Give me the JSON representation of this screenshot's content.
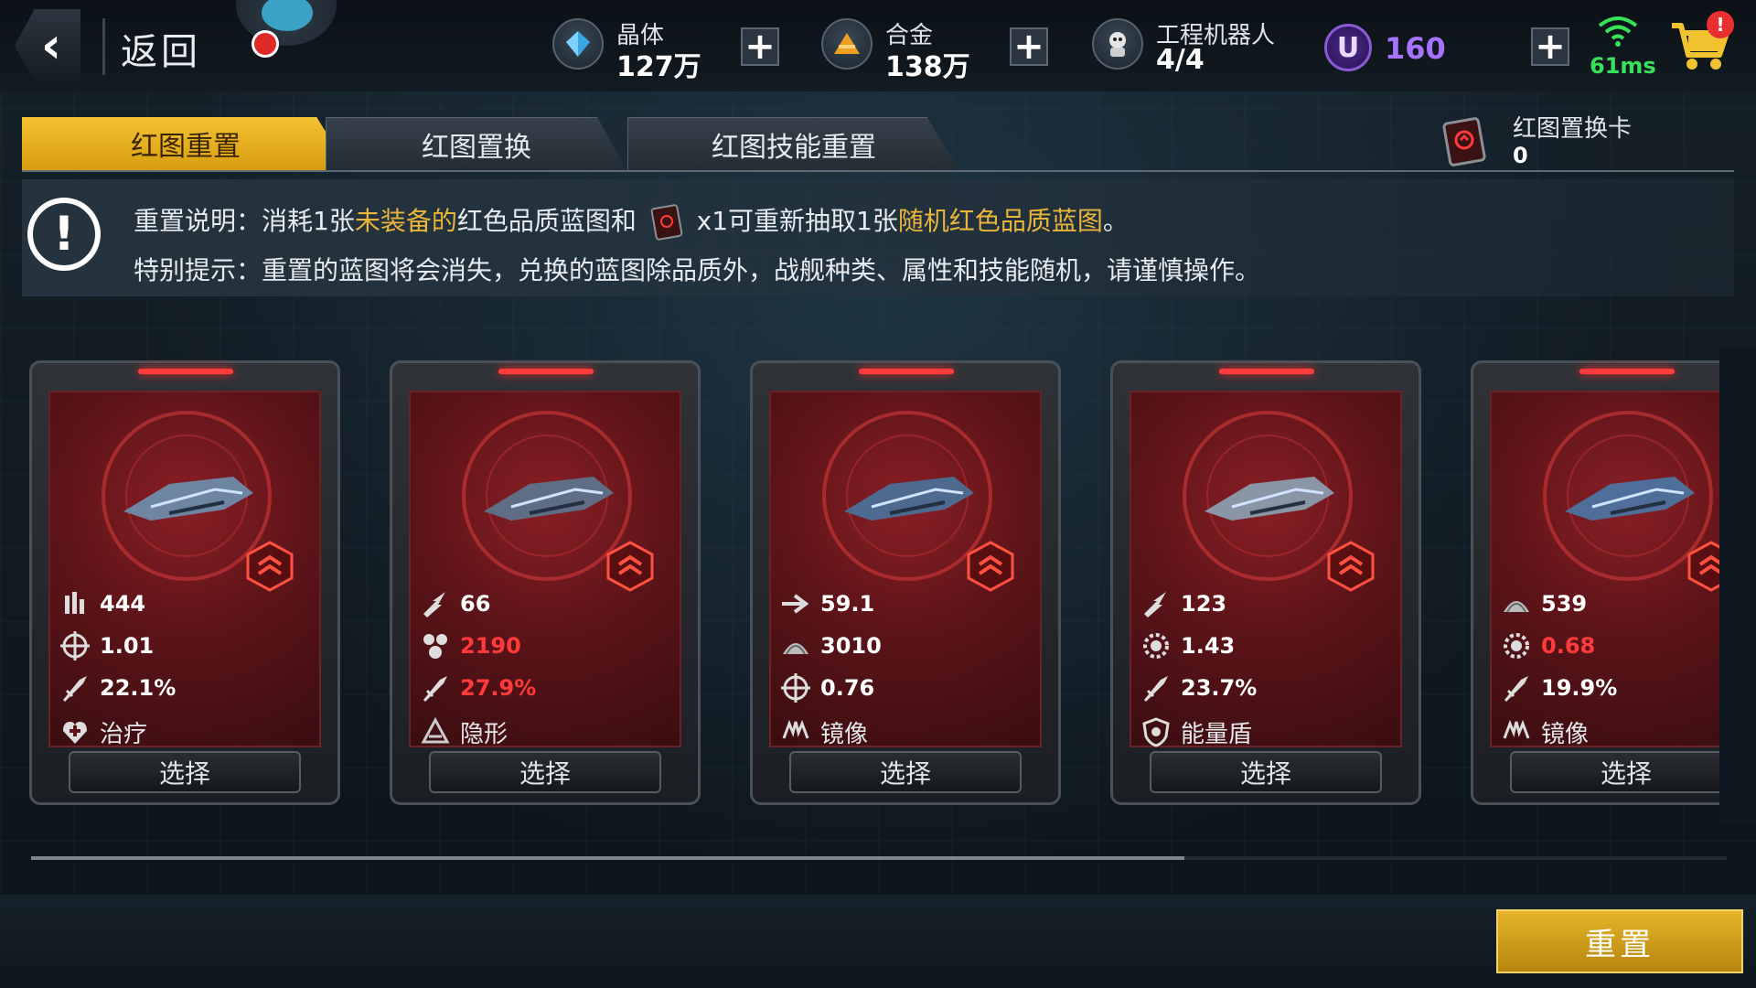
{
  "topbar": {
    "back_label": "返回",
    "resources": [
      {
        "name": "晶体",
        "value": "127万",
        "icon": "crystal-icon",
        "color": "#3aa7e6"
      },
      {
        "name": "合金",
        "value": "138万",
        "icon": "alloy-icon",
        "color": "#f0a020"
      },
      {
        "name": "工程机器人",
        "value": "4/4",
        "icon": "robot-icon",
        "color": "#e0e0e0"
      }
    ],
    "plus": "+",
    "u_label": "U",
    "u_value": "160",
    "ping": "61ms",
    "notification": "!"
  },
  "tabs": [
    {
      "label": "红图重置",
      "active": true
    },
    {
      "label": "红图置换",
      "active": false
    },
    {
      "label": "红图技能重置",
      "active": false
    }
  ],
  "swap_card": {
    "label": "红图置换卡",
    "count": "0"
  },
  "notice": {
    "line1": {
      "a": "重置说明：消耗1张",
      "b": "未装备的",
      "c": "红色品质蓝图和",
      "d": "x1可重新抽取1张",
      "e": "随机红色品质蓝图",
      "f": "。"
    },
    "line2": "特别提示：重置的蓝图将会消失，兑换的蓝图除品质外，战舰种类、属性和技能随机，请谨慎操作。"
  },
  "cards": [
    {
      "stats": [
        {
          "icon": "ammo-icon",
          "value": "444",
          "red": false
        },
        {
          "icon": "crosshair-icon",
          "value": "1.01",
          "red": false
        },
        {
          "icon": "missile-icon",
          "value": "22.1%",
          "red": false
        }
      ],
      "skill": {
        "icon": "heal-icon",
        "label": "治疗"
      },
      "select": "选择"
    },
    {
      "stats": [
        {
          "icon": "strike-icon",
          "value": "66",
          "red": false
        },
        {
          "icon": "cluster-icon",
          "value": "2190",
          "red": true
        },
        {
          "icon": "missile-icon",
          "value": "27.9%",
          "red": true
        }
      ],
      "skill": {
        "icon": "stealth-icon",
        "label": "隐形"
      },
      "select": "选择"
    },
    {
      "stats": [
        {
          "icon": "arrow-icon",
          "value": "59.1",
          "red": false
        },
        {
          "icon": "armor-icon",
          "value": "3010",
          "red": false
        },
        {
          "icon": "crosshair-icon",
          "value": "0.76",
          "red": false
        }
      ],
      "skill": {
        "icon": "mirror-icon",
        "label": "镜像"
      },
      "select": "选择"
    },
    {
      "stats": [
        {
          "icon": "strike-icon",
          "value": "123",
          "red": false
        },
        {
          "icon": "gear-icon",
          "value": "1.43",
          "red": false
        },
        {
          "icon": "missile-icon",
          "value": "23.7%",
          "red": false
        }
      ],
      "skill": {
        "icon": "shield-icon",
        "label": "能量盾"
      },
      "select": "选择"
    },
    {
      "stats": [
        {
          "icon": "armor-icon",
          "value": "539",
          "red": false
        },
        {
          "icon": "gear-icon",
          "value": "0.68",
          "red": true
        },
        {
          "icon": "missile-icon",
          "value": "19.9%",
          "red": false
        }
      ],
      "skill": {
        "icon": "mirror-icon",
        "label": "镜像"
      },
      "select": "选择"
    }
  ],
  "scroll_fraction": 0.68,
  "reset_button": "重置"
}
